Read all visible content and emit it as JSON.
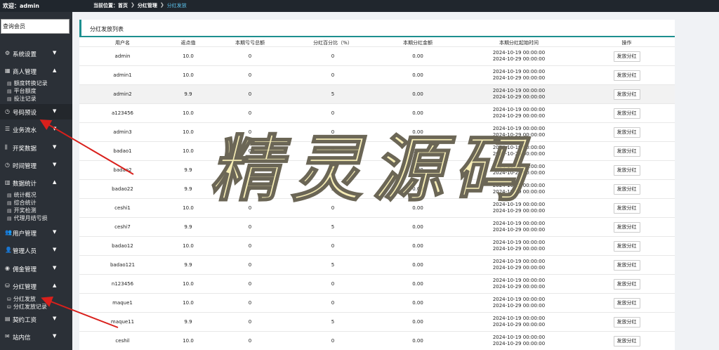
{
  "topbar": {
    "welcome": "欢迎：admin",
    "crumbs": [
      "当前位置：首页",
      "分红管理",
      "分红发放"
    ]
  },
  "sidebar": {
    "search_value": "查询会员",
    "items": [
      {
        "label": "系统设置",
        "icon": "gear-icon",
        "glyph": "⚙",
        "arrow": "▼"
      },
      {
        "label": "商人管理",
        "icon": "grid-icon",
        "glyph": "▦",
        "arrow": "▲"
      },
      {
        "label": "号码预设",
        "icon": "clock-icon",
        "glyph": "◷",
        "arrow": "▼"
      },
      {
        "label": "业务流水",
        "icon": "list-icon",
        "glyph": "☰",
        "arrow": "▼"
      },
      {
        "label": "开奖数据",
        "icon": "chart-icon",
        "glyph": "⫼",
        "arrow": "▼"
      },
      {
        "label": "时间管理",
        "icon": "clock-icon",
        "glyph": "◷",
        "arrow": "▼"
      },
      {
        "label": "数据统计",
        "icon": "bar-chart-icon",
        "glyph": "▥",
        "arrow": "▲"
      },
      {
        "label": "用户管理",
        "icon": "users-icon",
        "glyph": "👥",
        "arrow": "▼"
      },
      {
        "label": "管理人员",
        "icon": "user-icon",
        "glyph": "👤",
        "arrow": "▼"
      },
      {
        "label": "佣金管理",
        "icon": "coin-icon",
        "glyph": "◉",
        "arrow": "▼"
      },
      {
        "label": "分红管理",
        "icon": "database-icon",
        "glyph": "⛁",
        "arrow": "▲"
      },
      {
        "label": "契约工资",
        "icon": "contract-icon",
        "glyph": "▤",
        "arrow": "▼"
      },
      {
        "label": "站内信",
        "icon": "mail-icon",
        "glyph": "✉",
        "arrow": "▼"
      }
    ],
    "sub_merchant": [
      "额度转换记录",
      "平台额度",
      "投注记录"
    ],
    "sub_stats": [
      "统计概况",
      "综合统计",
      "开奖检测",
      "代理月结亏损"
    ],
    "sub_dividend": [
      "分红发放",
      "分红发放记录"
    ]
  },
  "panel": {
    "title": "分红发放列表"
  },
  "table": {
    "headers": [
      "用户名",
      "返点值",
      "本期亏亏总额",
      "分红百分比（%）",
      "本期分红金额",
      "本期分红起始时间",
      "操作"
    ],
    "start": "2024-10-19 00:00:00",
    "end": "2024-10-29 00:00:00",
    "action": "发放分红",
    "rows": [
      {
        "user": "admin",
        "rebate": "10.0",
        "loss": "0",
        "pct": "0",
        "amount": "0.00"
      },
      {
        "user": "admin1",
        "rebate": "10.0",
        "loss": "0",
        "pct": "0",
        "amount": "0.00"
      },
      {
        "user": "admin2",
        "rebate": "9.9",
        "loss": "0",
        "pct": "5",
        "amount": "0.00"
      },
      {
        "user": "a123456",
        "rebate": "10.0",
        "loss": "0",
        "pct": "0",
        "amount": "0.00"
      },
      {
        "user": "admin3",
        "rebate": "10.0",
        "loss": "0",
        "pct": "0",
        "amount": "0.00"
      },
      {
        "user": "badao1",
        "rebate": "10.0",
        "loss": "0",
        "pct": "0",
        "amount": "0.00"
      },
      {
        "user": "badao2",
        "rebate": "9.9",
        "loss": "0",
        "pct": "5",
        "amount": "0.00"
      },
      {
        "user": "badao22",
        "rebate": "9.9",
        "loss": "0",
        "pct": "5",
        "amount": "0.00"
      },
      {
        "user": "ceshi1",
        "rebate": "10.0",
        "loss": "0",
        "pct": "0",
        "amount": "0.00"
      },
      {
        "user": "ceshi7",
        "rebate": "9.9",
        "loss": "0",
        "pct": "5",
        "amount": "0.00"
      },
      {
        "user": "badao12",
        "rebate": "10.0",
        "loss": "0",
        "pct": "0",
        "amount": "0.00"
      },
      {
        "user": "badao121",
        "rebate": "9.9",
        "loss": "0",
        "pct": "5",
        "amount": "0.00"
      },
      {
        "user": "n123456",
        "rebate": "10.0",
        "loss": "0",
        "pct": "0",
        "amount": "0.00"
      },
      {
        "user": "maque1",
        "rebate": "10.0",
        "loss": "0",
        "pct": "0",
        "amount": "0.00"
      },
      {
        "user": "maque11",
        "rebate": "9.9",
        "loss": "0",
        "pct": "5",
        "amount": "0.00"
      },
      {
        "user": "ceshil",
        "rebate": "10.0",
        "loss": "0",
        "pct": "0",
        "amount": "0.00"
      }
    ]
  },
  "watermark": "精灵源码",
  "colors": {
    "sidebar": "#2b3037",
    "topbar": "#20262d",
    "accent": "#1d8f8f",
    "crumb_current": "#5cc3ee",
    "arrow": "#d9201c"
  }
}
